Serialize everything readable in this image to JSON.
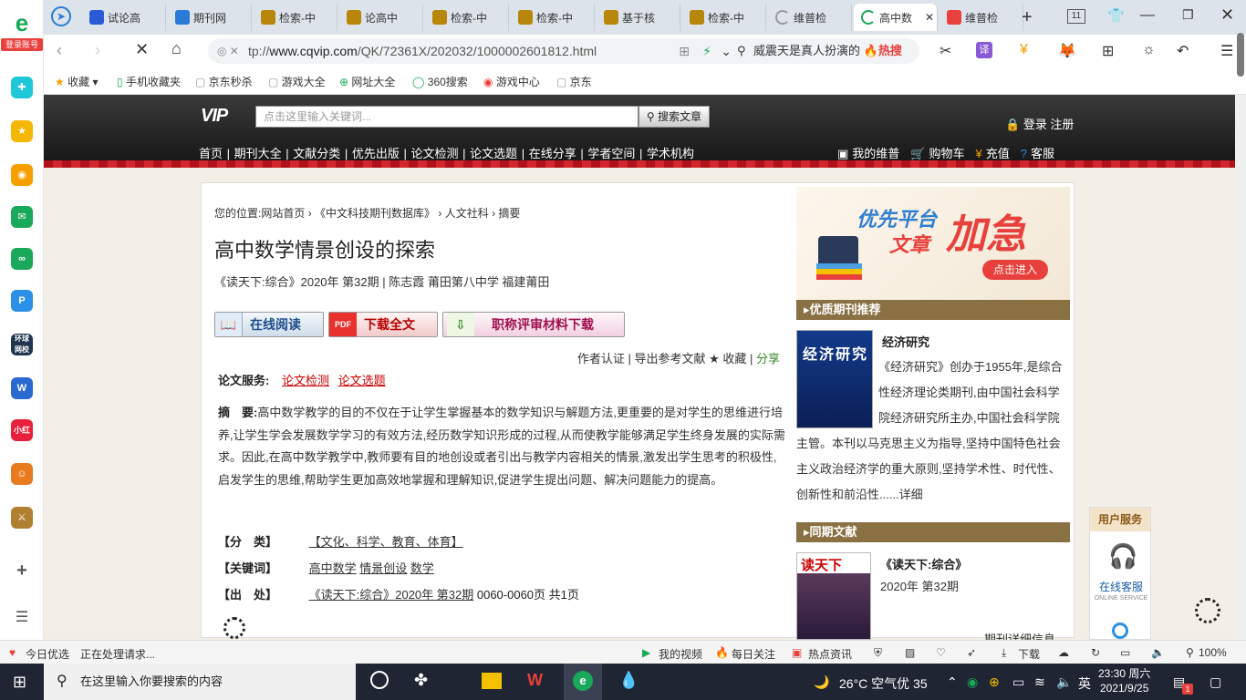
{
  "sidebar": {
    "login_label": "登录账号",
    "logo_glyph": "e"
  },
  "tabs": [
    {
      "label": "试论高",
      "icon": "baidu-icon",
      "color": "#2a5ad6"
    },
    {
      "label": "期刊网",
      "icon": "globe-icon",
      "color": "#2a7ad6"
    },
    {
      "label": "检索-中",
      "icon": "zhi-icon",
      "color": "#b8860b"
    },
    {
      "label": "论高中",
      "icon": "zhi-icon",
      "color": "#b8860b"
    },
    {
      "label": "检索-中",
      "icon": "zhi-icon",
      "color": "#b8860b"
    },
    {
      "label": "检索-中",
      "icon": "zhi-icon",
      "color": "#b8860b"
    },
    {
      "label": "基于核",
      "icon": "zhi-icon",
      "color": "#b8860b"
    },
    {
      "label": "检索-中",
      "icon": "zhi-icon",
      "color": "#b8860b"
    },
    {
      "label": "维普检",
      "icon": "loading-icon",
      "color": "#999999"
    },
    {
      "label": "高中数",
      "icon": "loading-icon",
      "color": "#1aa85a",
      "active": true
    },
    {
      "label": "维普检",
      "icon": "weipu-icon",
      "color": "#e8403c"
    }
  ],
  "tabcount": "11",
  "address": {
    "prefix": "tp://",
    "host": "www.cqvip.com",
    "path": "/QK/72361X/202032/1000002601812.html"
  },
  "search_box": {
    "text": "威震天是真人扮演的",
    "hot": "🔥热搜"
  },
  "bookmarks": [
    {
      "label": "收藏",
      "icon": "star-icon"
    },
    {
      "label": "手机收藏夹",
      "icon": "phone-icon"
    },
    {
      "label": "京东秒杀",
      "icon": "page-icon"
    },
    {
      "label": "游戏大全",
      "icon": "page-icon"
    },
    {
      "label": "网址大全",
      "icon": "plus-circle-icon"
    },
    {
      "label": "360搜索",
      "icon": "circle-icon"
    },
    {
      "label": "游戏中心",
      "icon": "game-icon"
    },
    {
      "label": "京东",
      "icon": "page-icon"
    }
  ],
  "site": {
    "logo": "VIP",
    "search_placeholder": "点击这里输入关键词...",
    "search_button": "搜索文章",
    "login": "登录 注册",
    "nav": [
      "首页",
      "期刊大全",
      "文献分类",
      "优先出版",
      "论文检测",
      "论文选题",
      "在线分享",
      "学者空间",
      "学术机构"
    ],
    "rnav": [
      "我的维普",
      "购物车",
      "充值",
      "客服"
    ]
  },
  "article": {
    "crumb_label": "您的位置:",
    "crumbs": [
      "网站首页",
      "《中文科技期刊数据库》",
      "人文社科",
      "摘要"
    ],
    "title": "高中数学情景创设的探索",
    "meta": "《读天下:综合》2020年 第32期 | 陈志霞   莆田第八中学 福建莆田",
    "btn_read": "在线阅读",
    "btn_download": "下载全文",
    "btn_material": "职称评审材料下载",
    "author_links": "作者认证 | 导出参考文献 ★ 收藏 |",
    "share": "分享",
    "services_label": "论文服务:",
    "services": [
      "论文检测",
      "论文选题"
    ],
    "abstract_label": "摘　要:",
    "abstract": "高中数学教学的目的不仅在于让学生掌握基本的数学知识与解题方法,更重要的是对学生的思维进行培养,让学生学会发展数学学习的有效方法,经历数学知识形成的过程,从而使教学能够满足学生终身发展的实际需求。因此,在高中数学教学中,教师要有目的地创设或者引出与教学内容相关的情景,激发出学生思考的积极性,启发学生的思维,帮助学生更加高效地掌握和理解知识,促进学生提出问题、解决问题能力的提高。",
    "category_label": "【分　类】",
    "category": "【文化、科学、教育、体育】",
    "keywords_label": "【关键词】",
    "keywords": [
      "高中数学",
      "情景创设",
      "数学"
    ],
    "source_label": "【出　处】",
    "source_link": "《读天下:综合》2020年 第32期",
    "source_pages": "0060-0060页 共1页"
  },
  "side": {
    "ad_t1": "优先平台",
    "ad_t2": "文章",
    "ad_t3": "加急",
    "ad_cta": "点击进入",
    "sec1": "优质期刊推荐",
    "journal_cover": "经济研究",
    "journal_name": "经济研究",
    "journal_desc": "《经济研究》创办于1955年,是综合性经济理论类期刊,由中国社会科学院经济研究所主办,中国社会科学院主管。本刊以马克思主义为指导,坚持中国特色社会主义政治经济学的重大原则,坚持学术性、时代性、创新性和前沿性......详细",
    "sec2": "同期文献",
    "issue_cover": "读天下",
    "issue_name": "《读天下:综合》",
    "issue_year": "2020年 第32期",
    "issue_detail": "期刊详细信息"
  },
  "user_service": {
    "header": "用户服务",
    "name": "在线客服",
    "sub": "ONLINE SERVICE"
  },
  "statusbar": {
    "left1": "今日优选",
    "left2": "正在处理请求...",
    "video": "我的视频",
    "daily": "每日关注",
    "news": "热点资讯",
    "download": "下载",
    "zoom": "100%"
  },
  "taskbar": {
    "search": "在这里输入你要搜索的内容",
    "weather": "26°C 空气优 35",
    "lang": "英",
    "time": "23:30 周六",
    "date": "2021/9/25",
    "notif": "1"
  }
}
